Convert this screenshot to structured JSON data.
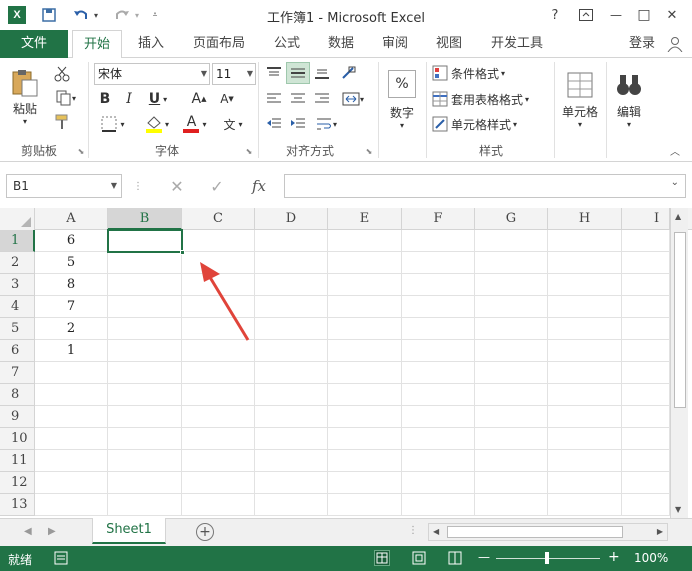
{
  "title": {
    "window_title": "工作簿1 - Microsoft Excel",
    "logo_text": "X",
    "help": "?",
    "minimize": "—",
    "maximize": "□",
    "close": "✕"
  },
  "tabs": [
    {
      "label": "文件"
    },
    {
      "label": "开始"
    },
    {
      "label": "插入"
    },
    {
      "label": "页面布局"
    },
    {
      "label": "公式"
    },
    {
      "label": "数据"
    },
    {
      "label": "审阅"
    },
    {
      "label": "视图"
    },
    {
      "label": "开发工具"
    }
  ],
  "signin": "登录",
  "ribbon": {
    "clipboard": {
      "paste": "粘贴",
      "group": "剪贴板"
    },
    "font": {
      "name": "宋体",
      "size": "11",
      "bold": "B",
      "italic": "I",
      "underline": "U",
      "grow": "A",
      "shrink": "A",
      "font_color_glyph": "A",
      "pinyin": "文",
      "group": "字体"
    },
    "align": {
      "group": "对齐方式"
    },
    "number": {
      "percent": "%",
      "label": "数字"
    },
    "styles": {
      "cond": "条件格式",
      "table": "套用表格格式",
      "cell": "单元格样式",
      "group": "样式"
    },
    "cells": {
      "label": "单元格"
    },
    "edit": {
      "label": "编辑"
    }
  },
  "formula": {
    "namebox": "B1",
    "cancel": "✕",
    "confirm": "✓",
    "fx": "fx",
    "value": ""
  },
  "columns": [
    "A",
    "B",
    "C",
    "D",
    "E",
    "F",
    "G",
    "H",
    "I"
  ],
  "rows": [
    "1",
    "2",
    "3",
    "4",
    "5",
    "6",
    "7",
    "8",
    "9",
    "10",
    "11",
    "12",
    "13"
  ],
  "col_a_values": [
    "6",
    "5",
    "8",
    "7",
    "2",
    "1"
  ],
  "sheet": {
    "name": "Sheet1",
    "add": "+"
  },
  "status": {
    "ready": "就绪",
    "zoom": "100%",
    "minus": "—",
    "plus": "+"
  },
  "colors": {
    "accent": "#217346",
    "selection": "#217346",
    "arrow": "#e0443a"
  }
}
